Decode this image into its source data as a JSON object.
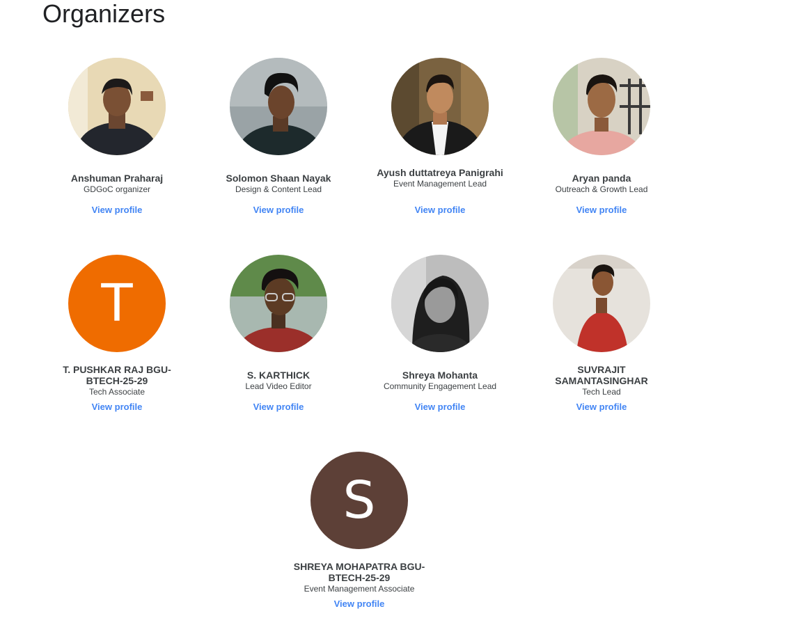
{
  "page": {
    "title": "Organizers"
  },
  "colors": {
    "link": "#4285f4",
    "name": "#3c4043",
    "avatar_t": "#ef6c00",
    "avatar_s": "#5d4037"
  },
  "organizers": [
    {
      "name": "Anshuman Praharaj",
      "role": "GDGoC organizer",
      "link": "View profile"
    },
    {
      "name": "Solomon Shaan Nayak",
      "role": "Design & Content Lead",
      "link": "View profile"
    },
    {
      "name": "Ayush duttatreya Panigrahi",
      "role": "Event Management Lead",
      "link": "View profile"
    },
    {
      "name": "Aryan panda",
      "role": "Outreach & Growth Lead",
      "link": "View profile"
    },
    {
      "name": "T. PUSHKAR RAJ BGU-BTECH-25-29",
      "role": "Tech Associate",
      "link": "View profile",
      "initial": "T"
    },
    {
      "name": "S. KARTHICK",
      "role": "Lead Video Editor",
      "link": "View profile"
    },
    {
      "name": "Shreya Mohanta",
      "role": "Community Engagement Lead",
      "link": "View profile"
    },
    {
      "name": "SUVRAJIT SAMANTASINGHAR",
      "role": "Tech Lead",
      "link": "View profile"
    },
    {
      "name": "SHREYA MOHAPATRA BGU-BTECH-25-29",
      "role": "Event Management Associate",
      "link": "View profile",
      "initial": "S"
    }
  ]
}
